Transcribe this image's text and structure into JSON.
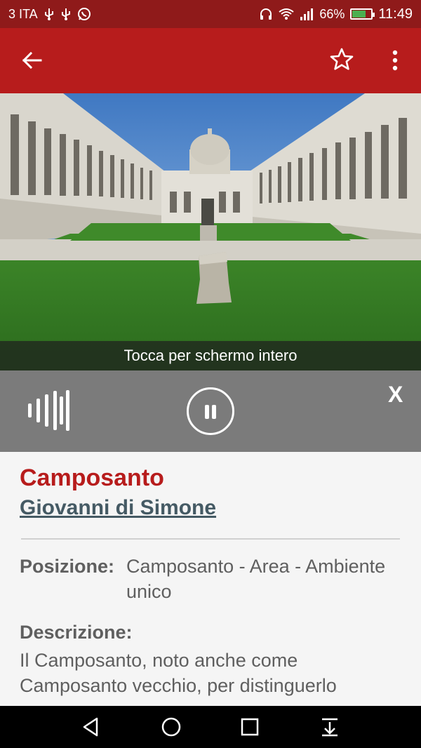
{
  "status_bar": {
    "carrier": "3 ITA",
    "battery_percent": "66%",
    "battery_level": 0.66,
    "time": "11:49"
  },
  "app_bar": {
    "icons": [
      "back-arrow-icon",
      "star-outline-icon",
      "more-vert-icon"
    ]
  },
  "hero": {
    "caption": "Tocca per schermo intero"
  },
  "player": {
    "close_label": "X",
    "icons": [
      "audio-wave-icon",
      "pause-icon"
    ]
  },
  "detail": {
    "title": "Camposanto",
    "author": "Giovanni di Simone",
    "position_label": "Posizione:",
    "position_value": "Camposanto - Area - Ambiente unico",
    "description_label": "Descrizione:",
    "description_text": "Il Camposanto, noto anche come Camposanto vecchio, per distinguerlo"
  },
  "nav_bar": {
    "icons": [
      "back-triangle-icon",
      "home-circle-icon",
      "recents-square-icon",
      "notification-pulldown-icon"
    ]
  },
  "colors": {
    "status_bar": "#8f1a1a",
    "app_bar": "#b71c1c",
    "title": "#b71c1c",
    "author": "#455a64",
    "player_bg": "#7b7b7b"
  }
}
